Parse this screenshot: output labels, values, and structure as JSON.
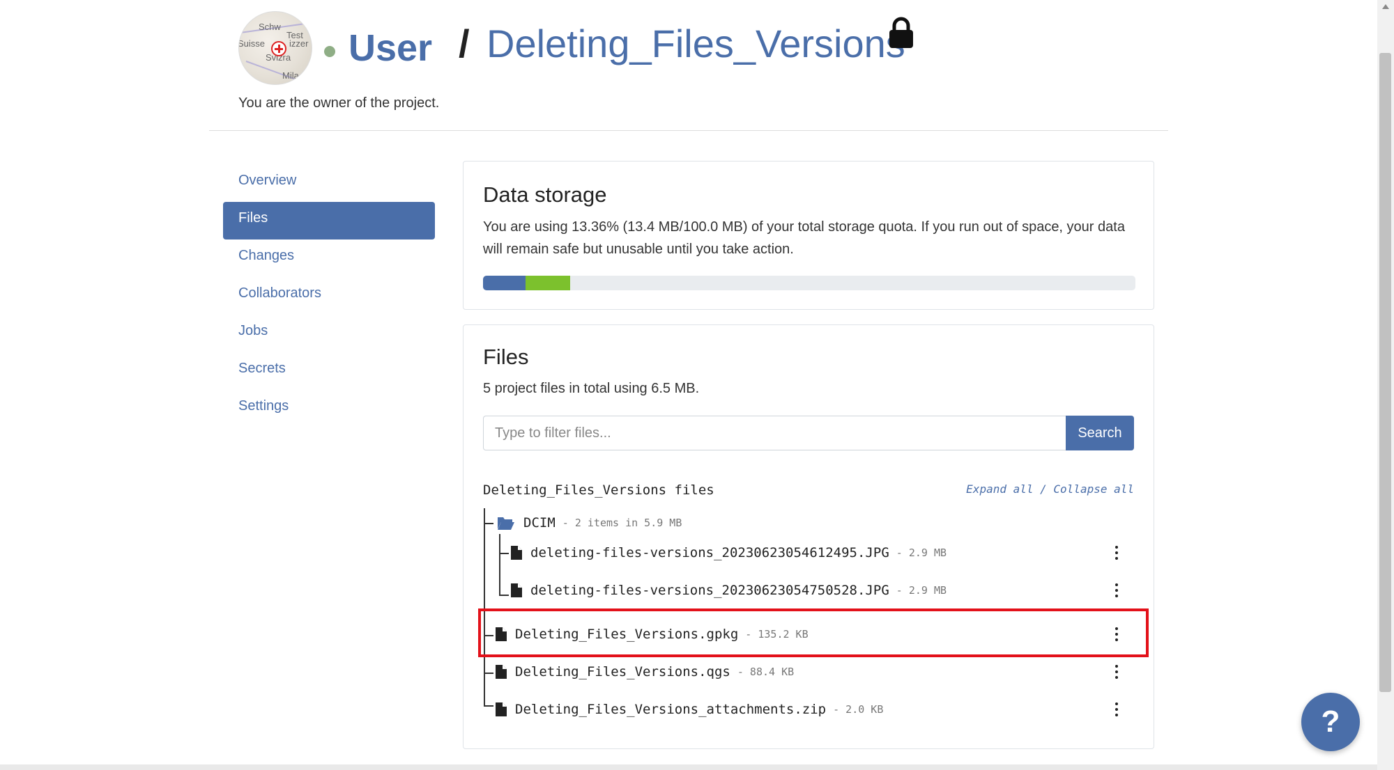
{
  "header": {
    "owner": "User",
    "separator": "/",
    "project": "Deleting_Files_Versions",
    "owner_note": "You are the owner of the project.",
    "avatar_map_labels": [
      "Schw",
      "Test",
      "Suisse",
      "izzer",
      "Svizra",
      "Mila"
    ],
    "lock_icon": "lock-icon"
  },
  "sidebar": {
    "items": [
      {
        "label": "Overview",
        "active": false
      },
      {
        "label": "Files",
        "active": true
      },
      {
        "label": "Changes",
        "active": false
      },
      {
        "label": "Collaborators",
        "active": false
      },
      {
        "label": "Jobs",
        "active": false
      },
      {
        "label": "Secrets",
        "active": false
      },
      {
        "label": "Settings",
        "active": false
      }
    ]
  },
  "storage": {
    "title": "Data storage",
    "text": "You are using 13.36% (13.4 MB/100.0 MB) of your total storage quota. If you run out of space, your data will remain safe but unusable until you take action.",
    "progress_segments": [
      {
        "percent": 6.5,
        "color": "#4a6ea9"
      },
      {
        "percent": 6.86,
        "color": "#7cc12d"
      }
    ]
  },
  "files": {
    "title": "Files",
    "summary": "5 project files in total using 6.5 MB.",
    "filter_placeholder": "Type to filter files...",
    "search_label": "Search",
    "tree_title": "Deleting_Files_Versions files",
    "expand_all": "Expand all",
    "controls_separator": " / ",
    "collapse_all": "Collapse all",
    "folder": {
      "name": "DCIM",
      "meta": "- 2 items in 5.9 MB",
      "icon": "folder-open-icon"
    },
    "folder_files": [
      {
        "name": "deleting-files-versions_20230623054612495.JPG",
        "meta": "- 2.9 MB"
      },
      {
        "name": "deleting-files-versions_20230623054750528.JPG",
        "meta": "- 2.9 MB"
      }
    ],
    "root_files": [
      {
        "name": "Deleting_Files_Versions.gpkg",
        "meta": "- 135.2 KB",
        "highlighted": true
      },
      {
        "name": "Deleting_Files_Versions.qgs",
        "meta": "- 88.4 KB"
      },
      {
        "name": "Deleting_Files_Versions_attachments.zip",
        "meta": "- 2.0 KB"
      }
    ]
  },
  "help_button": {
    "label": "?"
  },
  "colors": {
    "accent": "#4a6ea9",
    "highlight": "#e3111a",
    "progress_secondary": "#7cc12d"
  }
}
